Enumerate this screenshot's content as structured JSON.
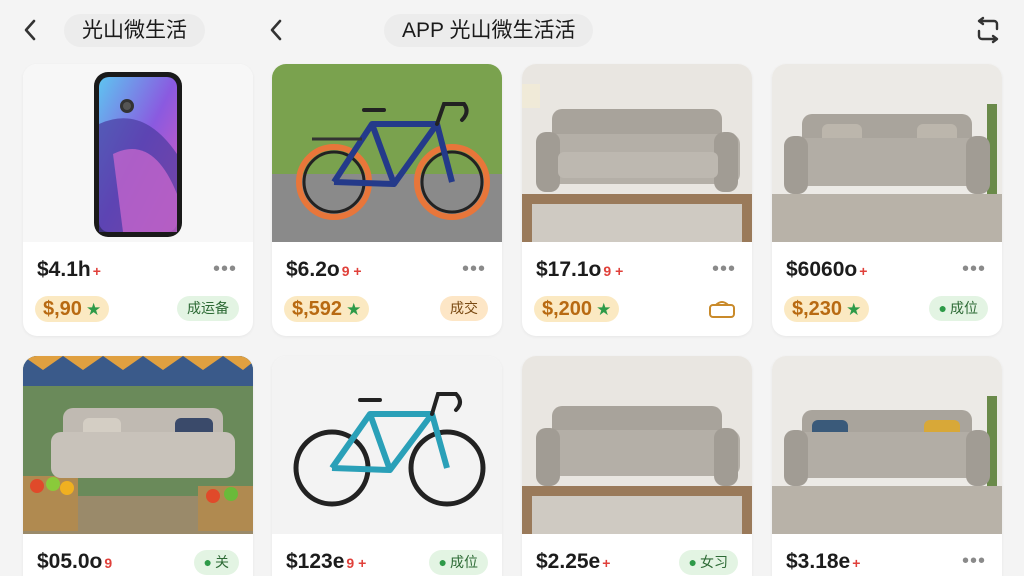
{
  "header": {
    "left_title": "光山微生活",
    "center_title": "APP 光山微生活活",
    "icons": [
      "back-arrow-icon",
      "refresh-icon"
    ]
  },
  "listings": [
    {
      "price": "$4.1h",
      "price_mark": "+",
      "rating": "$,90",
      "tag": "成运备",
      "tag_style": "green"
    },
    {
      "price": "$6.2o",
      "price_mark": "9 +",
      "rating": "$,592",
      "tag": "成交",
      "tag_style": "peach"
    },
    {
      "price": "$17.1o",
      "price_mark": "9 +",
      "rating": "$,200",
      "tag": "",
      "tag_style": "icon"
    },
    {
      "price": "$6060o",
      "price_mark": "+",
      "rating": "$,230",
      "tag": "成位",
      "tag_style": "green"
    },
    {
      "price": "$05.0o",
      "price_mark": "9",
      "rating": "",
      "tag": "关",
      "tag_style": "green"
    },
    {
      "price": "$123e",
      "price_mark": "9 +",
      "rating": "",
      "tag": "成位",
      "tag_style": "green"
    },
    {
      "price": "$2.25e",
      "price_mark": "+",
      "rating": "",
      "tag": "女习",
      "tag_style": "green"
    },
    {
      "price": "$3.18e",
      "price_mark": "+",
      "rating": "",
      "tag": "",
      "tag_style": "none"
    }
  ],
  "colors": {
    "rating_bg": "#fbe9c2",
    "rating_text": "#b86a12",
    "tag_green_bg": "#e3f4e3",
    "star": "#2e9a48",
    "price_mark": "#e0403a"
  }
}
